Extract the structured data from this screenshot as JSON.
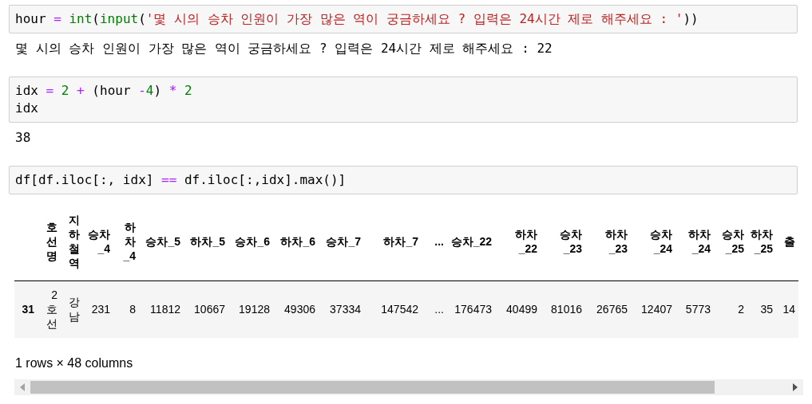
{
  "cells": [
    {
      "code": [
        [
          {
            "kind": "plain",
            "text": "hour"
          },
          {
            "kind": "op",
            "text": " = "
          },
          {
            "kind": "builtin",
            "text": "int"
          },
          {
            "kind": "plain",
            "text": "("
          },
          {
            "kind": "builtin",
            "text": "input"
          },
          {
            "kind": "plain",
            "text": "("
          },
          {
            "kind": "string",
            "text": "'몇 시의 승차 인원이 가장 많은 역이 궁금하세요 ? 입력은 24시간 제로 해주세요 : '"
          },
          {
            "kind": "plain",
            "text": "))"
          }
        ]
      ],
      "output": {
        "kind": "text",
        "text": "몇 시의 승차 인원이 가장 많은 역이 궁금하세요 ? 입력은 24시간 제로 해주세요 : 22"
      }
    },
    {
      "code": [
        [
          {
            "kind": "plain",
            "text": "idx"
          },
          {
            "kind": "op",
            "text": " = "
          },
          {
            "kind": "number",
            "text": "2"
          },
          {
            "kind": "op",
            "text": " + "
          },
          {
            "kind": "plain",
            "text": "(hour "
          },
          {
            "kind": "op",
            "text": "-"
          },
          {
            "kind": "number",
            "text": "4"
          },
          {
            "kind": "plain",
            "text": ")"
          },
          {
            "kind": "op",
            "text": " * "
          },
          {
            "kind": "number",
            "text": "2"
          }
        ],
        [
          {
            "kind": "plain",
            "text": "idx"
          }
        ]
      ],
      "output": {
        "kind": "text",
        "text": "38"
      }
    },
    {
      "code": [
        [
          {
            "kind": "plain",
            "text": "df[df.iloc[:, idx] "
          },
          {
            "kind": "op",
            "text": "=="
          },
          {
            "kind": "plain",
            "text": " df.iloc[:,idx].max()]"
          }
        ]
      ],
      "output": {
        "kind": "table",
        "columns": [
          "호선명",
          "지하철역",
          "승차_4",
          "하차_4",
          "승차_5",
          "하차_5",
          "승차_6",
          "하차_6",
          "승차_7",
          "하차_7",
          "...",
          "승차_22",
          "하차_22",
          "승차_23",
          "하차_23",
          "승차_24",
          "하차_24",
          "승차_25",
          "하차_25",
          "출"
        ],
        "rows": [
          {
            "index": "31",
            "cells": [
              "2호선",
              "강남",
              "231",
              "8",
              "11812",
              "10667",
              "19128",
              "49306",
              "37334",
              "147542",
              "...",
              "176473",
              "40499",
              "81016",
              "26765",
              "12407",
              "5773",
              "2",
              "35",
              "14"
            ]
          }
        ],
        "summary": "1 rows × 48 columns"
      }
    }
  ]
}
